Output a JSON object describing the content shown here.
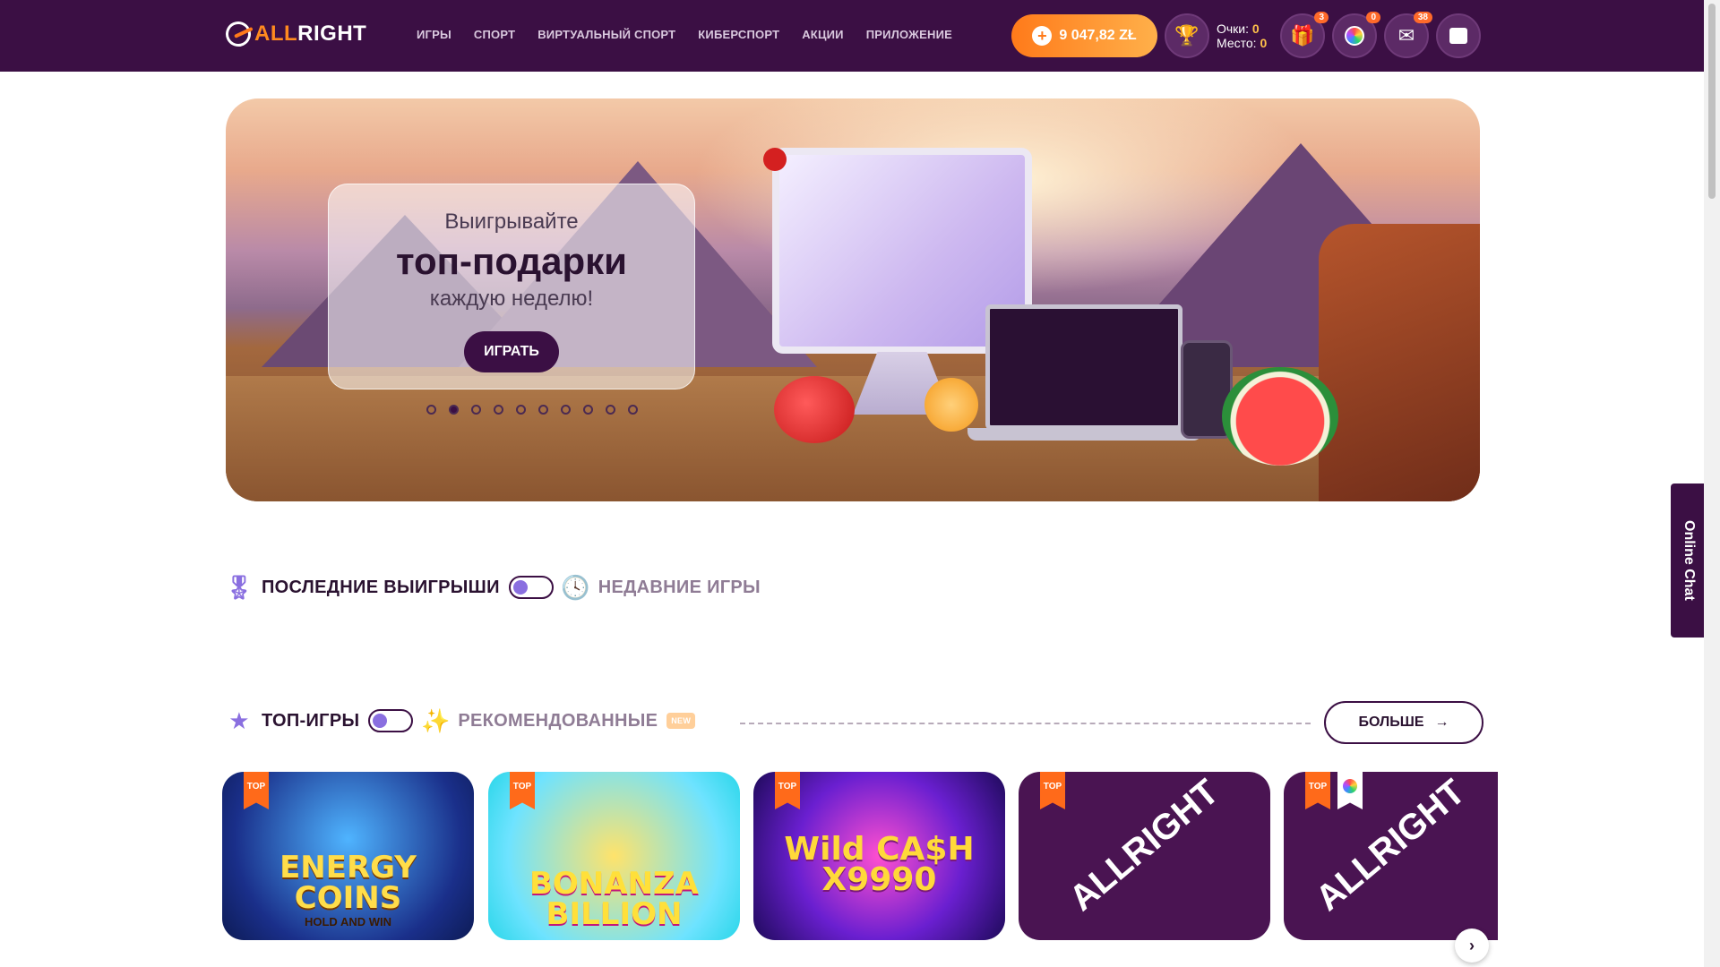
{
  "header": {
    "logo_all": "ALL",
    "logo_right": "RIGHT",
    "nav": [
      "ИГРЫ",
      "СПОРТ",
      "ВИРТУАЛЬНЫЙ СПОРТ",
      "КИБЕРСПОРТ",
      "АКЦИИ",
      "ПРИЛОЖЕНИЕ"
    ],
    "balance": "9 047,82 ZŁ",
    "score_label": "Очки:",
    "score_value": "0",
    "place_label": "Место:",
    "place_value": "0",
    "gift_count": "3",
    "wheel_count": "0",
    "mail_count": "38"
  },
  "banner": {
    "line1": "Выигрывайте",
    "line2": "топ-подарки",
    "line3": "каждую неделю!",
    "button": "ИГРАТЬ",
    "slides_total": 10,
    "active_slide": 2
  },
  "recent": {
    "title_active": "ПОСЛЕДНИЕ ВЫИГРЫШИ",
    "title_alt": "НЕДАВНИЕ ИГРЫ"
  },
  "top_games": {
    "title_active": "ТОП-ИГРЫ",
    "title_alt": "РЕКОМЕНДОВАННЫЕ",
    "new_tag": "NEW",
    "more_button": "БОЛЬШЕ",
    "badge": "TOP",
    "cards": [
      {
        "title": "ENERGY COINS",
        "subtitle": "HOLD AND WIN"
      },
      {
        "title": "BONANZA BILLION"
      },
      {
        "title": "Wild CA$H X9990"
      },
      {
        "title": "ALLRIGHT"
      },
      {
        "title": "ALLRIGHT"
      }
    ]
  },
  "chat": {
    "label": "Online Chat"
  },
  "colors": {
    "brand": "#3b0f44",
    "accent": "#ff7a1a"
  }
}
